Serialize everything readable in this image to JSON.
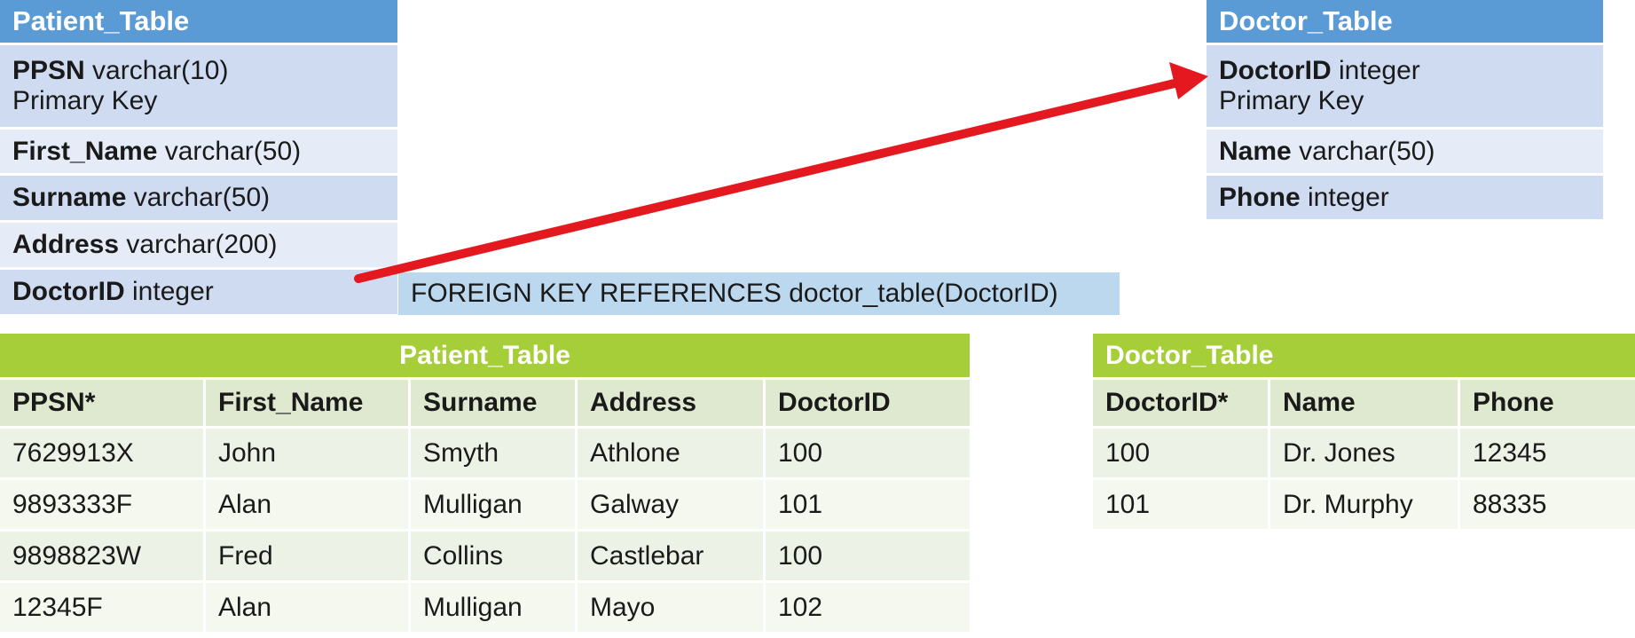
{
  "colors": {
    "schema_header": "#5b9bd5",
    "schema_row_dark": "#cfdbf1",
    "schema_row_light": "#e6ecf7",
    "fk_note_bg": "#bcd8ef",
    "data_header": "#a6ce39",
    "arrow": "#e3191f"
  },
  "patient_schema": {
    "title": "Patient_Table",
    "fields": [
      {
        "name": "PPSN",
        "type": "varchar(10)",
        "note": "Primary Key"
      },
      {
        "name": "First_Name",
        "type": "varchar(50)"
      },
      {
        "name": "Surname",
        "type": "varchar(50)"
      },
      {
        "name": "Address",
        "type": "varchar(200)"
      },
      {
        "name": "DoctorID",
        "type": "integer"
      }
    ]
  },
  "doctor_schema": {
    "title": "Doctor_Table",
    "fields": [
      {
        "name": "DoctorID",
        "type": "integer",
        "note": "Primary Key"
      },
      {
        "name": "Name",
        "type": "varchar(50)"
      },
      {
        "name": "Phone",
        "type": "integer"
      }
    ]
  },
  "foreign_key_note": "FOREIGN KEY REFERENCES doctor_table(DoctorID)",
  "patient_data": {
    "title": "Patient_Table",
    "columns": [
      "PPSN*",
      "First_Name",
      "Surname",
      "Address",
      "DoctorID"
    ],
    "rows": [
      [
        "7629913X",
        "John",
        "Smyth",
        "Athlone",
        "100"
      ],
      [
        "9893333F",
        "Alan",
        "Mulligan",
        "Galway",
        "101"
      ],
      [
        "9898823W",
        "Fred",
        "Collins",
        "Castlebar",
        "100"
      ],
      [
        "12345F",
        "Alan",
        "Mulligan",
        "Mayo",
        "102"
      ]
    ]
  },
  "doctor_data": {
    "title": "Doctor_Table",
    "columns": [
      "DoctorID*",
      "Name",
      "Phone"
    ],
    "rows": [
      [
        "100",
        "Dr. Jones",
        "12345"
      ],
      [
        "101",
        "Dr. Murphy",
        "88335"
      ]
    ]
  }
}
